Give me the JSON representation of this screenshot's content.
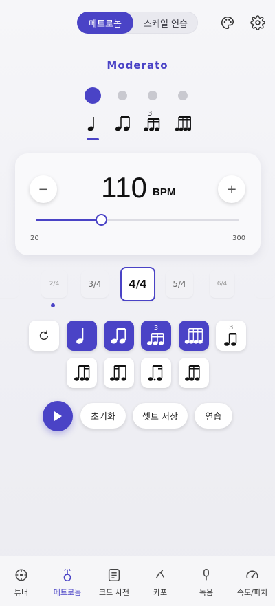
{
  "header": {
    "mode_tabs": [
      {
        "label": "메트로놈",
        "active": true
      },
      {
        "label": "스케일 연습",
        "active": false
      }
    ],
    "palette_icon": "palette-icon",
    "settings_icon": "gear-icon"
  },
  "tempo_marking": "Moderato",
  "subdivision_indicator": {
    "dots_count": 4,
    "active_index": 0,
    "notes": [
      "quarter",
      "eighths",
      "triplet",
      "sixteenths"
    ],
    "triplet_label": "3"
  },
  "bpm": {
    "value": "110",
    "unit": "BPM",
    "min_label": "20",
    "max_label": "300",
    "slider_fraction": 0.32,
    "decrease_label": "−",
    "increase_label": "+"
  },
  "time_signatures": [
    {
      "label": "2/4",
      "active": false
    },
    {
      "label": "3/4",
      "active": false
    },
    {
      "label": "4/4",
      "active": true
    },
    {
      "label": "5/4",
      "active": false
    },
    {
      "label": "6/4",
      "active": false
    }
  ],
  "rhythm_buttons": {
    "reset_icon": "reset-icon",
    "triplet_label": "3",
    "row1": [
      "quarter",
      "eighths",
      "triplet",
      "sixteenths",
      "eighth-triplet"
    ],
    "row2": [
      "eighth-two-sixteenths",
      "two-sixteenths-eighth",
      "dotted-eighth-sixteenth",
      "sixteenth-dotted-eighth"
    ]
  },
  "actions": {
    "play_icon": "play-icon",
    "reset_label": "초기화",
    "save_set_label": "셋트 저장",
    "practice_label": "연습"
  },
  "bottom_nav": [
    {
      "label": "튜너",
      "icon": "tuner-icon",
      "active": false
    },
    {
      "label": "메트로놈",
      "icon": "metronome-icon",
      "active": true
    },
    {
      "label": "코드 사전",
      "icon": "chord-dictionary-icon",
      "active": false
    },
    {
      "label": "카포",
      "icon": "capo-icon",
      "active": false
    },
    {
      "label": "녹음",
      "icon": "microphone-icon",
      "active": false
    },
    {
      "label": "속도/피치",
      "icon": "speedometer-icon",
      "active": false
    }
  ],
  "colors": {
    "accent": "#4a43c6",
    "background": "#f3f3f6"
  }
}
